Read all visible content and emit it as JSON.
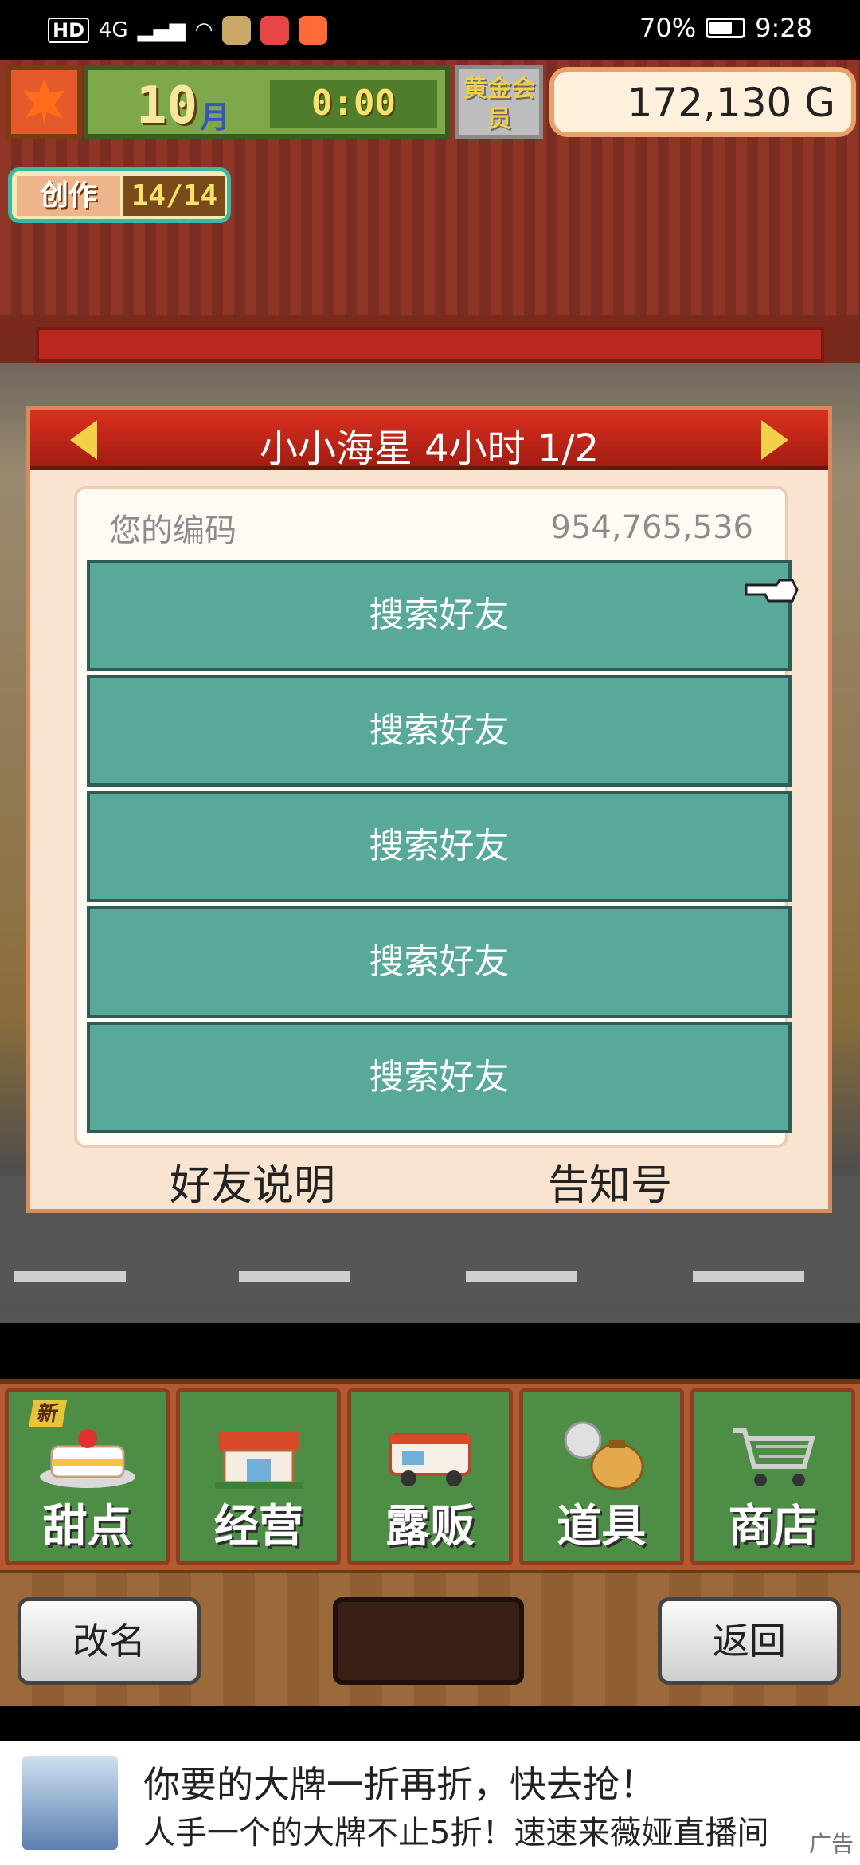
{
  "statusbar": {
    "hd": "HD",
    "network": "4G",
    "battery_percent": "70%",
    "battery_level": 0.7,
    "time": "9:28"
  },
  "hud": {
    "month": "10",
    "month_label": "月",
    "clock": "0:00",
    "gold_member": "黄金会员",
    "money": "172,130 G",
    "create_label": "创作",
    "create_count": "14/14"
  },
  "dialog": {
    "title": "小小海星  4小时 1/2",
    "code_label": "您的编码",
    "code_value": "954,765,536",
    "friends": [
      {
        "label": "搜索好友"
      },
      {
        "label": "搜索好友"
      },
      {
        "label": "搜索好友"
      },
      {
        "label": "搜索好友"
      },
      {
        "label": "搜索好友"
      }
    ],
    "footer_left": "好友说明",
    "footer_right": "告知号"
  },
  "menu": {
    "items": [
      {
        "label": "甜点",
        "icon": "cake-icon",
        "tag": "新"
      },
      {
        "label": "经营",
        "icon": "shop-icon"
      },
      {
        "label": "露贩",
        "icon": "food-truck-icon"
      },
      {
        "label": "道具",
        "icon": "items-bag-icon"
      },
      {
        "label": "商店",
        "icon": "shopping-cart-icon"
      }
    ]
  },
  "bottom": {
    "rename": "改名",
    "back": "返回"
  },
  "ad": {
    "line1": "你要的大牌一折再折，快去抢！",
    "line2": "人手一个的大牌不止5折！速速来薇娅直播间",
    "tag": "广告"
  },
  "colors": {
    "teal_button": "#58a99a",
    "dialog_header": "#c4261a",
    "menu_green": "#4e8d46"
  }
}
